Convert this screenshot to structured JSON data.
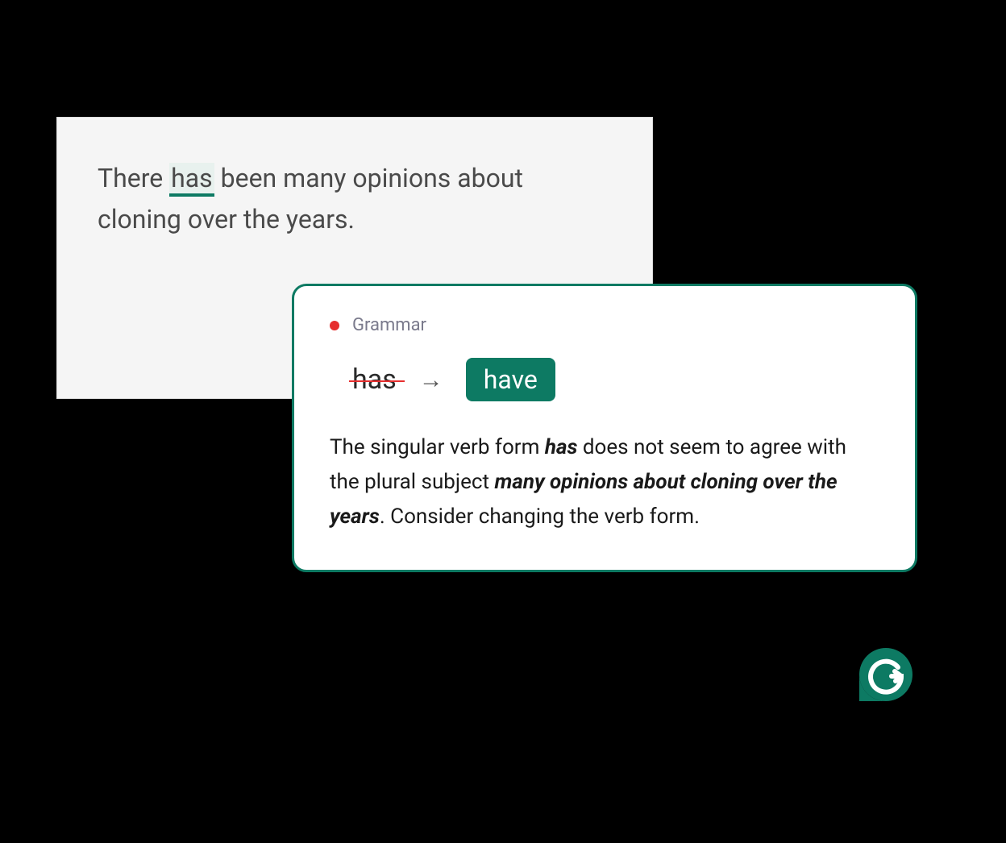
{
  "editor": {
    "text_before": "There ",
    "highlighted": "has",
    "text_after": " been many opinions about cloning over the years."
  },
  "suggestion": {
    "category": "Grammar",
    "original_word": "has",
    "arrow": "→",
    "replacement_word": "have",
    "explanation_parts": {
      "p1": "The singular verb form ",
      "b1": "has",
      "p2": " does not seem to agree with the plural subject ",
      "b2": "many opinions about cloning over the years",
      "p3": ". Consider changing the verb form."
    }
  },
  "colors": {
    "accent": "#0d7a63",
    "error": "#e62e2e"
  }
}
